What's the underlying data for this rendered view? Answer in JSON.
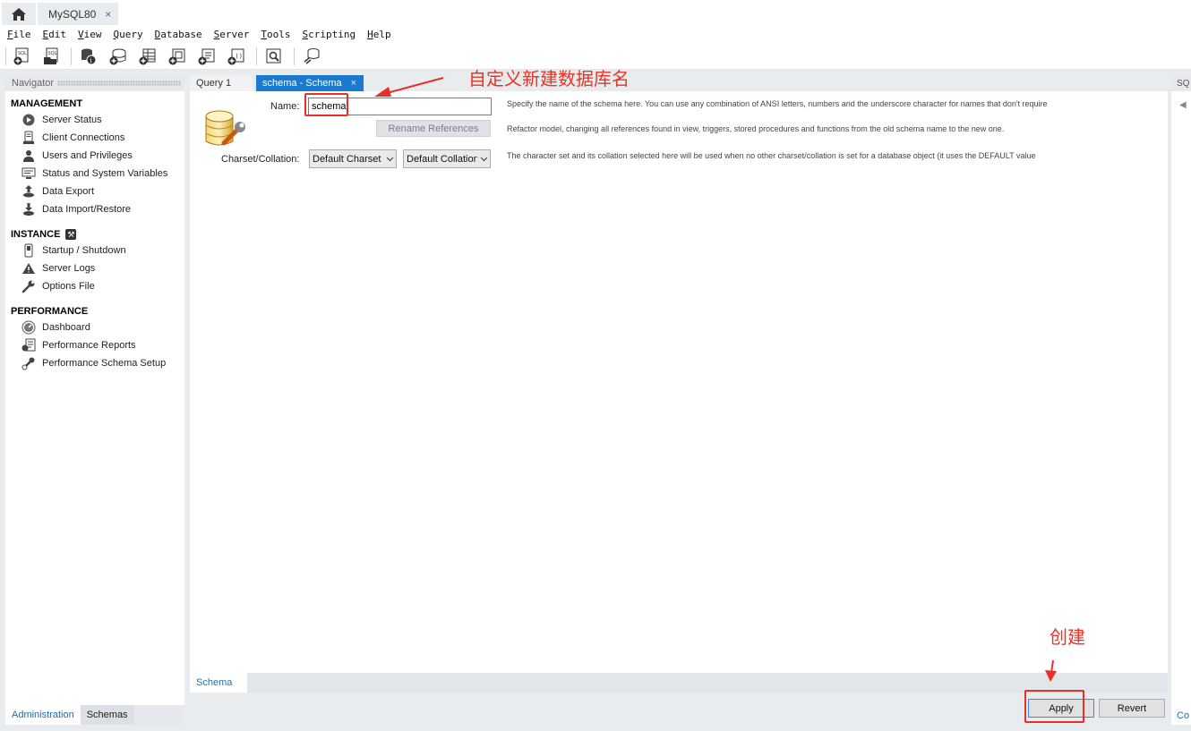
{
  "window": {
    "connection_tab": "MySQL80",
    "home_icon": "home-icon",
    "close_glyph": "×"
  },
  "menu": [
    "File",
    "Edit",
    "View",
    "Query",
    "Database",
    "Server",
    "Tools",
    "Scripting",
    "Help"
  ],
  "toolbar": {
    "buttons": [
      "new-sql-tab-icon",
      "open-sql-script-icon",
      "inspector-icon",
      "create-schema-icon",
      "create-table-icon",
      "create-view-icon",
      "create-procedure-icon",
      "create-function-icon",
      "search-table-data-icon",
      "reconnect-icon"
    ]
  },
  "navigator": {
    "title": "Navigator",
    "sections": [
      {
        "title": "MANAGEMENT",
        "items": [
          "Server Status",
          "Client Connections",
          "Users and Privileges",
          "Status and System Variables",
          "Data Export",
          "Data Import/Restore"
        ]
      },
      {
        "title": "INSTANCE",
        "items": [
          "Startup / Shutdown",
          "Server Logs",
          "Options File"
        ]
      },
      {
        "title": "PERFORMANCE",
        "items": [
          "Dashboard",
          "Performance Reports",
          "Performance Schema Setup"
        ]
      }
    ],
    "footer_tabs": [
      "Administration",
      "Schemas"
    ]
  },
  "editor": {
    "tabs": [
      "Query 1",
      "schema - Schema"
    ],
    "name_label": "Name:",
    "name_value": "schema",
    "rename_button": "Rename References",
    "charset_label": "Charset/Collation:",
    "charset_value": "Default Charset",
    "collation_value": "Default Collation",
    "hints": [
      "Specify the name of the schema here. You can use any combination of ANSI letters, numbers and the underscore character for names that don't require",
      "Refactor model, changing all references found in view, triggers, stored procedures and functions from the old schema name to the new one.",
      "The character set and its collation selected here will be used when no other charset/collation is set for a database object (it uses the DEFAULT value"
    ],
    "subtab": "Schema",
    "apply_button": "Apply",
    "revert_button": "Revert"
  },
  "right_panel": {
    "header": "SQ",
    "footer": "Co"
  },
  "annotations": {
    "name_note": "自定义新建数据库名",
    "apply_note": "创建",
    "color": "#e8302a"
  },
  "colors": {
    "accent": "#1a7acf",
    "link": "#1a6fb4"
  }
}
